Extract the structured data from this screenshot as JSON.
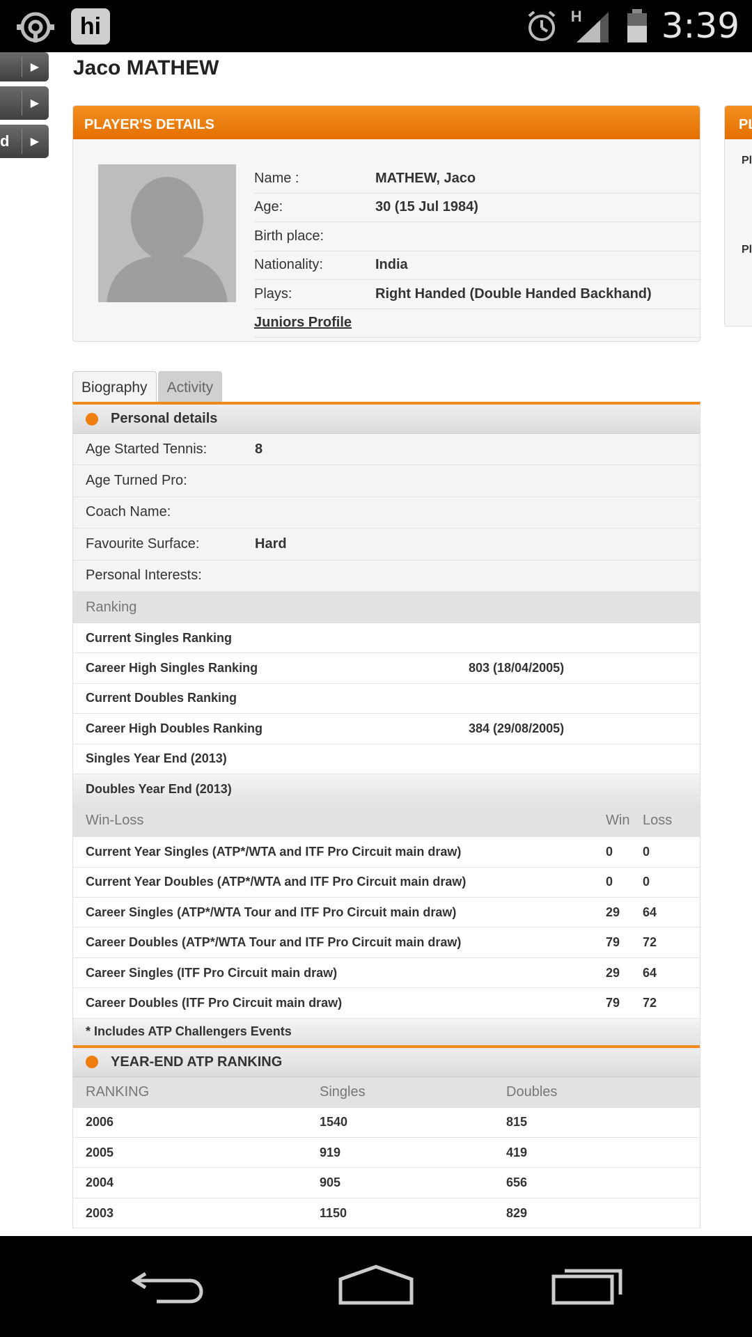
{
  "status_bar": {
    "time": "3:39",
    "network": "H",
    "app_badge": "hi",
    "icons": [
      "sync-icon",
      "hi-app-icon",
      "alarm-icon",
      "signal-icon",
      "battery-icon"
    ]
  },
  "left_tabs": [
    {
      "label": ""
    },
    {
      "label": ""
    },
    {
      "label": "d"
    }
  ],
  "player": {
    "display_name": "Jaco MATHEW"
  },
  "details": {
    "header": "PLAYER'S DETAILS",
    "rows": [
      {
        "label": "Name :",
        "value": "MATHEW, Jaco"
      },
      {
        "label": "Age:",
        "value": "30 (15 Jul 1984)"
      },
      {
        "label": "Birth place:",
        "value": ""
      },
      {
        "label": "Nationality:",
        "value": "India"
      },
      {
        "label": "Plays:",
        "value": "Right Handed (Double Handed Backhand)"
      }
    ],
    "juniors_link": "Juniors Profile"
  },
  "side_card": {
    "header": "PL",
    "items": [
      "Pl",
      "Pl"
    ]
  },
  "tabs": [
    {
      "label": "Biography",
      "active": true
    },
    {
      "label": "Activity",
      "active": false
    }
  ],
  "personal": {
    "header": "Personal details",
    "rows": [
      {
        "label": "Age Started Tennis:",
        "value": "8"
      },
      {
        "label": "Age Turned Pro:",
        "value": ""
      },
      {
        "label": "Coach Name:",
        "value": ""
      },
      {
        "label": "Favourite Surface:",
        "value": "Hard"
      },
      {
        "label": "Personal Interests:",
        "value": ""
      }
    ]
  },
  "ranking": {
    "header": "Ranking",
    "rows": [
      {
        "label": "Current Singles Ranking",
        "value": ""
      },
      {
        "label": "Career High Singles Ranking",
        "value": "803 (18/04/2005)"
      },
      {
        "label": "Current Doubles Ranking",
        "value": ""
      },
      {
        "label": "Career High Doubles Ranking",
        "value": "384 (29/08/2005)"
      },
      {
        "label": "Singles Year End (2013)",
        "value": ""
      },
      {
        "label": "Doubles Year End (2013)",
        "value": ""
      }
    ]
  },
  "win_loss": {
    "header": "Win-Loss",
    "win_label": "Win",
    "loss_label": "Loss",
    "rows": [
      {
        "label": "Current Year Singles (ATP*/WTA and ITF Pro Circuit main draw)",
        "win": "0",
        "loss": "0"
      },
      {
        "label": "Current Year Doubles (ATP*/WTA and ITF Pro Circuit main draw)",
        "win": "0",
        "loss": "0"
      },
      {
        "label": "Career Singles (ATP*/WTA Tour and ITF Pro Circuit main draw)",
        "win": "29",
        "loss": "64"
      },
      {
        "label": "Career Doubles (ATP*/WTA Tour and ITF Pro Circuit main draw)",
        "win": "79",
        "loss": "72"
      },
      {
        "label": "Career Singles (ITF Pro Circuit main draw)",
        "win": "29",
        "loss": "64"
      },
      {
        "label": "Career Doubles (ITF Pro Circuit main draw)",
        "win": "79",
        "loss": "72"
      }
    ],
    "note": "* Includes ATP Challengers Events"
  },
  "year_end": {
    "header": "YEAR-END ATP RANKING",
    "columns": [
      "RANKING",
      "Singles",
      "Doubles"
    ],
    "rows": [
      {
        "year": "2006",
        "singles": "1540",
        "doubles": "815"
      },
      {
        "year": "2005",
        "singles": "919",
        "doubles": "419"
      },
      {
        "year": "2004",
        "singles": "905",
        "doubles": "656"
      },
      {
        "year": "2003",
        "singles": "1150",
        "doubles": "829"
      }
    ]
  },
  "nav_bar": {
    "icons": [
      "back-icon",
      "home-icon",
      "recent-apps-icon"
    ]
  },
  "colors": {
    "accent_orange": "#f08a1c",
    "header_gray": "#e2e2e2"
  }
}
